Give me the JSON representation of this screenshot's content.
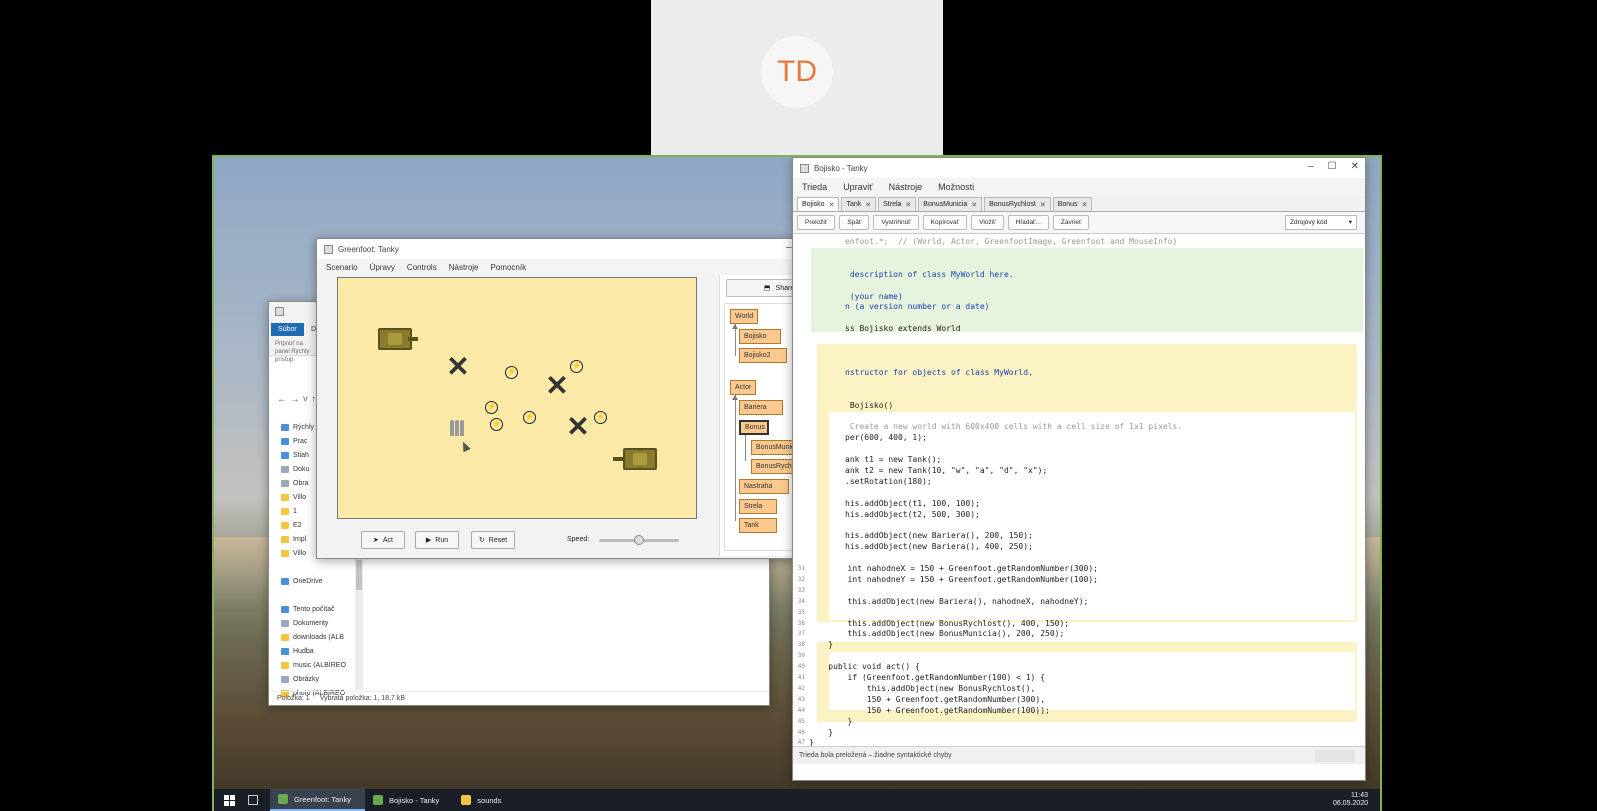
{
  "meeting": {
    "avatar_initials": "TD"
  },
  "explorer": {
    "tab_label": "Súbor",
    "tab_label_2": "D",
    "pin_label": "Pripnúť na panel Rýchly prístup",
    "nav_arrows": "← → ˅ ↑",
    "items": [
      {
        "label": "Rýchly",
        "kind": "star"
      },
      {
        "label": "Prac",
        "kind": "blue"
      },
      {
        "label": "Stiah",
        "kind": "blue"
      },
      {
        "label": "Doku",
        "kind": "doc"
      },
      {
        "label": "Obra",
        "kind": "doc"
      },
      {
        "label": "Villo",
        "kind": "folder"
      },
      {
        "label": "1",
        "kind": "folder"
      },
      {
        "label": "E2",
        "kind": "folder"
      },
      {
        "label": "Impl",
        "kind": "folder"
      },
      {
        "label": "Villo",
        "kind": "folder"
      },
      {
        "label": "",
        "kind": "spacer"
      },
      {
        "label": "OneDrive",
        "kind": "blue"
      },
      {
        "label": "",
        "kind": "spacer"
      },
      {
        "label": "Tento počítač",
        "kind": "blue"
      },
      {
        "label": "Dokumenty",
        "kind": "doc"
      },
      {
        "label": "downloads (ALB",
        "kind": "folder"
      },
      {
        "label": "Hudba",
        "kind": "blue"
      },
      {
        "label": "music (ALBIREO",
        "kind": "folder"
      },
      {
        "label": "Obrázky",
        "kind": "doc"
      },
      {
        "label": "photo (ALBIREO",
        "kind": "folder"
      }
    ],
    "status_count": "Položka: 1",
    "status_selected": "Vybratá položka: 1, 18,7 kB"
  },
  "greenfoot": {
    "title": "Greenfoot: Tanky",
    "menu": [
      "Scenario",
      "Úpravy",
      "Controls",
      "Nástroje",
      "Pomocník"
    ],
    "share_label": "Share...",
    "classes": {
      "world": "World",
      "bojisko": "Bojisko",
      "bojisko2": "Bojisko2",
      "actor": "Actor",
      "bariera": "Bariera",
      "bonus": "Bonus",
      "bonusmunicia": "BonusMunicia",
      "bonusrychlost": "BonusRychlost",
      "nastraha": "Nastraha",
      "strela": "Strela",
      "tank": "Tank"
    },
    "act_label": "Act",
    "run_label": "Run",
    "reset_label": "Reset",
    "speed_label": "Speed:",
    "speed_level": 0.5
  },
  "editor": {
    "title": "Bojisko - Tanky",
    "menu": [
      "Trieda",
      "Upraviť",
      "Nástroje",
      "Možnosti"
    ],
    "tabs": [
      "Bojisko",
      "Tank",
      "Strela",
      "BonusMunicia",
      "BonusRychlost",
      "Bonus"
    ],
    "toolbar": [
      "Preložiť",
      "Späť",
      "Vystrihnúť",
      "Kopírovať",
      "Vložiť",
      "Hľadať...",
      "Zavrieť"
    ],
    "view_select": "Zdrojový kód",
    "status": "Trieda bola preložená – žiadne syntaktické chyby",
    "code": [
      {
        "n": "",
        "t": "enfoot.*;  // (World, Actor, GreenfootImage, Greenfoot and MouseInfo)"
      },
      {
        "n": "",
        "t": ""
      },
      {
        "n": "",
        "t": ""
      },
      {
        "n": "",
        "t": " description of class MyWorld here."
      },
      {
        "n": "",
        "t": ""
      },
      {
        "n": "",
        "t": " (your name)"
      },
      {
        "n": "",
        "t": "n (a version number or a date)"
      },
      {
        "n": "",
        "t": ""
      },
      {
        "n": "",
        "t": "ss Bojisko extends World"
      },
      {
        "n": "",
        "t": ""
      },
      {
        "n": "",
        "t": ""
      },
      {
        "n": "",
        "t": ""
      },
      {
        "n": "",
        "t": "nstructor for objects of class MyWorld."
      },
      {
        "n": "",
        "t": ""
      },
      {
        "n": "",
        "t": ""
      },
      {
        "n": "",
        "t": " Bojisko()"
      },
      {
        "n": "",
        "t": ""
      },
      {
        "n": "",
        "t": " Create a new world with 600x400 cells with a cell size of 1x1 pixels."
      },
      {
        "n": "",
        "t": "per(600, 400, 1);"
      },
      {
        "n": "",
        "t": ""
      },
      {
        "n": "",
        "t": "ank t1 = new Tank();"
      },
      {
        "n": "",
        "t": "ank t2 = new Tank(10, \"w\", \"a\", \"d\", \"x\");"
      },
      {
        "n": "",
        "t": ".setRotation(180);"
      },
      {
        "n": "",
        "t": ""
      },
      {
        "n": "",
        "t": "his.addObject(t1, 100, 100);"
      },
      {
        "n": "",
        "t": "his.addObject(t2, 500, 300);"
      },
      {
        "n": "",
        "t": ""
      },
      {
        "n": "",
        "t": "his.addObject(new Bariera(), 200, 150);"
      },
      {
        "n": "",
        "t": "his.addObject(new Bariera(), 400, 250);"
      },
      {
        "n": "",
        "t": ""
      },
      {
        "n": "31",
        "t": "        int nahodneX = 150 + Greenfoot.getRandomNumber(300);"
      },
      {
        "n": "32",
        "t": "        int nahodneY = 150 + Greenfoot.getRandomNumber(100);"
      },
      {
        "n": "33",
        "t": ""
      },
      {
        "n": "34",
        "t": "        this.addObject(new Bariera(), nahodneX, nahodneY);"
      },
      {
        "n": "35",
        "t": ""
      },
      {
        "n": "36",
        "t": "        this.addObject(new BonusRychlost(), 400, 150);"
      },
      {
        "n": "37",
        "t": "        this.addObject(new BonusMunicia(), 200, 250);"
      },
      {
        "n": "38",
        "t": "    }"
      },
      {
        "n": "39",
        "t": ""
      },
      {
        "n": "40",
        "t": "    public void act() {"
      },
      {
        "n": "41",
        "t": "        if (Greenfoot.getRandomNumber(100) < 1) {"
      },
      {
        "n": "42",
        "t": "            this.addObject(new BonusRychlost(),"
      },
      {
        "n": "43",
        "t": "            150 + Greenfoot.getRandomNumber(300),"
      },
      {
        "n": "44",
        "t": "            150 + Greenfoot.getRandomNumber(100));"
      },
      {
        "n": "45",
        "t": "        }"
      },
      {
        "n": "46",
        "t": "    }"
      },
      {
        "n": "47",
        "t": "}"
      },
      {
        "n": "48",
        "t": ""
      }
    ]
  },
  "taskbar": {
    "items": [
      "Greenfoot: Tanky",
      "Bojisko - Tanky",
      "sounds"
    ],
    "time": "11:43",
    "date": "06.05.2020"
  },
  "colors": {
    "accent": "#1f6cb5",
    "class_fill": "#fbc98d",
    "world_bg": "#fbe9a8",
    "avatar_text": "#e8793d"
  }
}
